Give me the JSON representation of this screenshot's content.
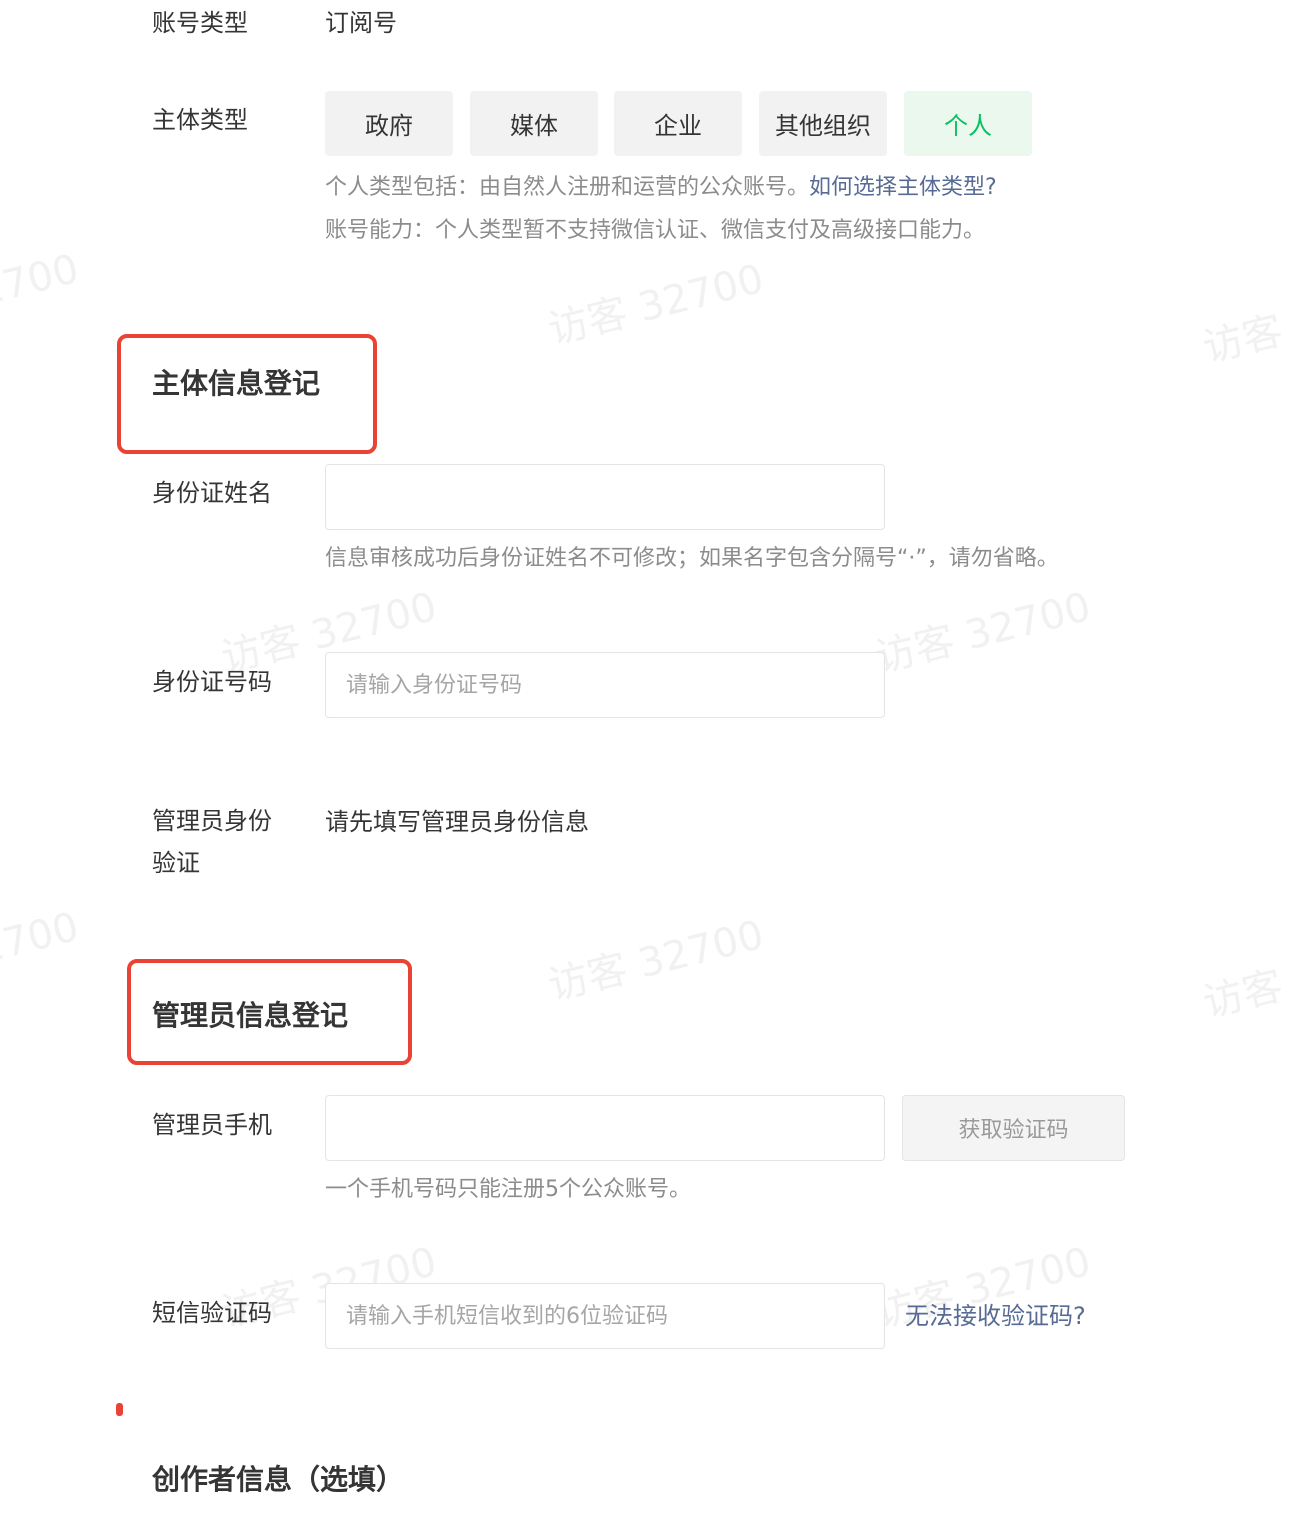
{
  "watermark": {
    "text": "访客 32700"
  },
  "account": {
    "type_label": "账号类型",
    "type_value": "订阅号"
  },
  "subject": {
    "label": "主体类型",
    "options": [
      "政府",
      "媒体",
      "企业",
      "其他组织",
      "个人"
    ],
    "selected": "个人",
    "desc_line1": "个人类型包括：由自然人注册和运营的公众账号。",
    "desc_link": "如何选择主体类型?",
    "desc_line2": "账号能力：个人类型暂不支持微信认证、微信支付及高级接口能力。"
  },
  "subject_info": {
    "title": "主体信息登记",
    "id_name_label": "身份证姓名",
    "id_name_value": "",
    "id_name_hint": "信息审核成功后身份证姓名不可修改；如果名字包含分隔号“·”，请勿省略。",
    "id_number_label": "身份证号码",
    "id_number_placeholder": "请输入身份证号码",
    "admin_verify_label_1": "管理员身份",
    "admin_verify_label_2": "验证",
    "admin_verify_value": "请先填写管理员身份信息"
  },
  "admin_info": {
    "title": "管理员信息登记",
    "phone_label": "管理员手机",
    "phone_value": "",
    "get_code_button": "获取验证码",
    "phone_hint": "一个手机号码只能注册5个公众账号。",
    "sms_label": "短信验证码",
    "sms_placeholder": "请输入手机短信收到的6位验证码",
    "sms_help_link": "无法接收验证码?"
  },
  "creator": {
    "title": "创作者信息（选填）"
  },
  "colors": {
    "accent_green": "#07c160",
    "link_blue": "#576b95",
    "highlight_red": "#e84335"
  }
}
